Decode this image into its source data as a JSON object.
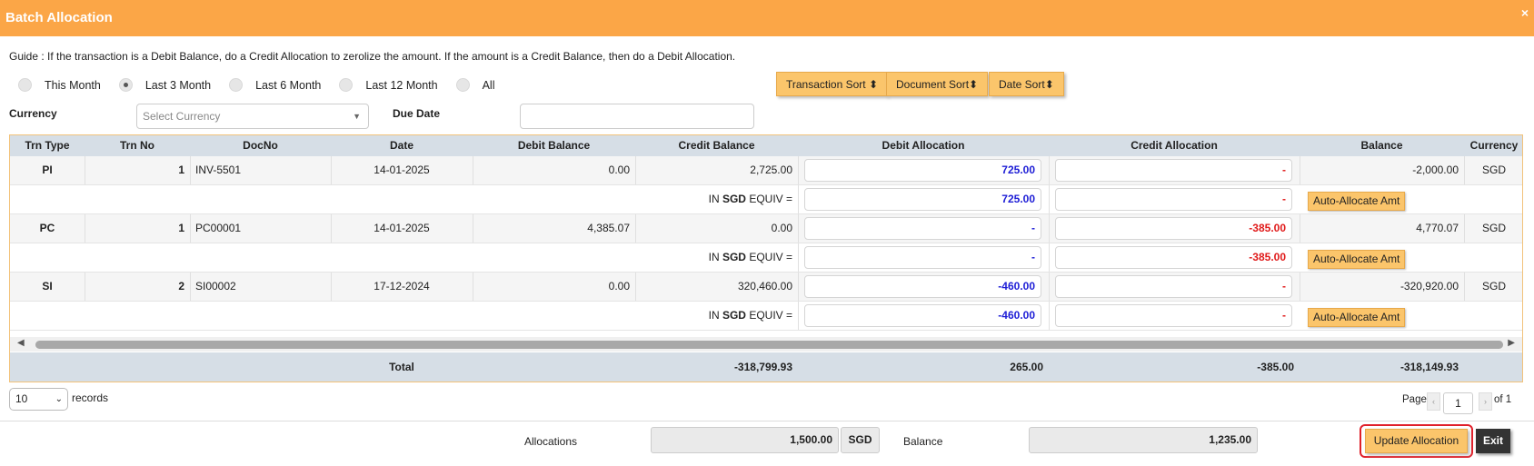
{
  "window": {
    "title": "Batch Allocation",
    "close_glyph": "×"
  },
  "guide": "Guide : If the transaction is a Debit Balance, do a Credit Allocation to zerolize the amount. If the amount is a Credit Balance, then do a Debit Allocation.",
  "period_options": [
    {
      "label": "This Month",
      "checked": false
    },
    {
      "label": "Last 3 Month",
      "checked": true
    },
    {
      "label": "Last 6 Month",
      "checked": false
    },
    {
      "label": "Last 12 Month",
      "checked": false
    },
    {
      "label": "All",
      "checked": false
    }
  ],
  "sort_buttons": {
    "transaction": "Transaction Sort",
    "document": "Document Sort",
    "date": "Date Sort",
    "sort_glyph": "⬍"
  },
  "filters": {
    "currency_label": "Currency",
    "currency_placeholder": "Select Currency",
    "due_date_label": "Due Date",
    "due_date_value": ""
  },
  "table": {
    "headers": {
      "trn_type": "Trn Type",
      "trn_no": "Trn No",
      "doc_no": "DocNo",
      "date": "Date",
      "debit_balance": "Debit Balance",
      "credit_balance": "Credit Balance",
      "debit_allocation": "Debit Allocation",
      "credit_allocation": "Credit Allocation",
      "balance": "Balance",
      "currency": "Currency"
    },
    "equiv": {
      "prefix": "IN",
      "currency": "SGD",
      "suffix": "EQUIV ="
    },
    "auto_allocate_label": "Auto-Allocate Amt",
    "rows": [
      {
        "trn_type": "PI",
        "trn_no": "1",
        "doc_no": "INV-5501",
        "date": "14-01-2025",
        "debit_balance": "0.00",
        "credit_balance": "2,725.00",
        "debit_alloc": "725.00",
        "credit_alloc": "-",
        "balance": "-2,000.00",
        "currency": "SGD",
        "equiv_debit": "725.00",
        "equiv_credit": "-"
      },
      {
        "trn_type": "PC",
        "trn_no": "1",
        "doc_no": "PC00001",
        "date": "14-01-2025",
        "debit_balance": "4,385.07",
        "credit_balance": "0.00",
        "debit_alloc": "-",
        "credit_alloc": "-385.00",
        "balance": "4,770.07",
        "currency": "SGD",
        "equiv_debit": "-",
        "equiv_credit": "-385.00"
      },
      {
        "trn_type": "SI",
        "trn_no": "2",
        "doc_no": "SI00002",
        "date": "17-12-2024",
        "debit_balance": "0.00",
        "credit_balance": "320,460.00",
        "debit_alloc": "-460.00",
        "credit_alloc": "-",
        "balance": "-320,920.00",
        "currency": "SGD",
        "equiv_debit": "-460.00",
        "equiv_credit": "-"
      }
    ],
    "total": {
      "label": "Total",
      "credit_balance": "-318,799.93",
      "debit_alloc": "265.00",
      "credit_alloc": "-385.00",
      "balance": "-318,149.93"
    }
  },
  "pagination": {
    "page_size": "10",
    "records_label": "records",
    "page_label": "Page",
    "page_value": "1",
    "of_label": "of 1",
    "prev_glyph": "‹",
    "next_glyph": "›"
  },
  "footer": {
    "allocations_label": "Allocations",
    "allocations_value": "1,500.00",
    "allocations_currency": "SGD",
    "balance_label": "Balance",
    "balance_value": "1,235.00"
  },
  "actions": {
    "update": "Update Allocation",
    "exit": "Exit"
  },
  "colors": {
    "accent": "#fba647",
    "button": "#fbc56b",
    "debit_text": "#1d1dd6",
    "credit_text": "#e01a1a",
    "header_bg": "#d6dee6"
  }
}
